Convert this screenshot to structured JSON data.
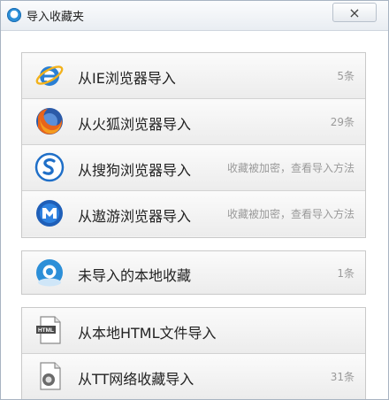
{
  "window": {
    "title": "导入收藏夹",
    "close_label": "×"
  },
  "browsers": [
    {
      "label": "从IE浏览器导入",
      "meta": "5条",
      "icon": "ie-icon"
    },
    {
      "label": "从火狐浏览器导入",
      "meta": "29条",
      "icon": "firefox-icon"
    },
    {
      "label": "从搜狗浏览器导入",
      "meta": "收藏被加密，查看导入方法",
      "icon": "sogou-icon"
    },
    {
      "label": "从遨游浏览器导入",
      "meta": "收藏被加密，查看导入方法",
      "icon": "maxthon-icon"
    }
  ],
  "local": {
    "label": "未导入的本地收藏",
    "meta": "1条",
    "icon": "local-cloud-icon"
  },
  "files": [
    {
      "label": "从本地HTML文件导入",
      "meta": "",
      "icon": "html-file-icon"
    },
    {
      "label": "从TT网络收藏导入",
      "meta": "31条",
      "icon": "tt-file-icon"
    }
  ],
  "colors": {
    "accent": "#2c8fd8",
    "meta_text": "#9a9a9a"
  }
}
